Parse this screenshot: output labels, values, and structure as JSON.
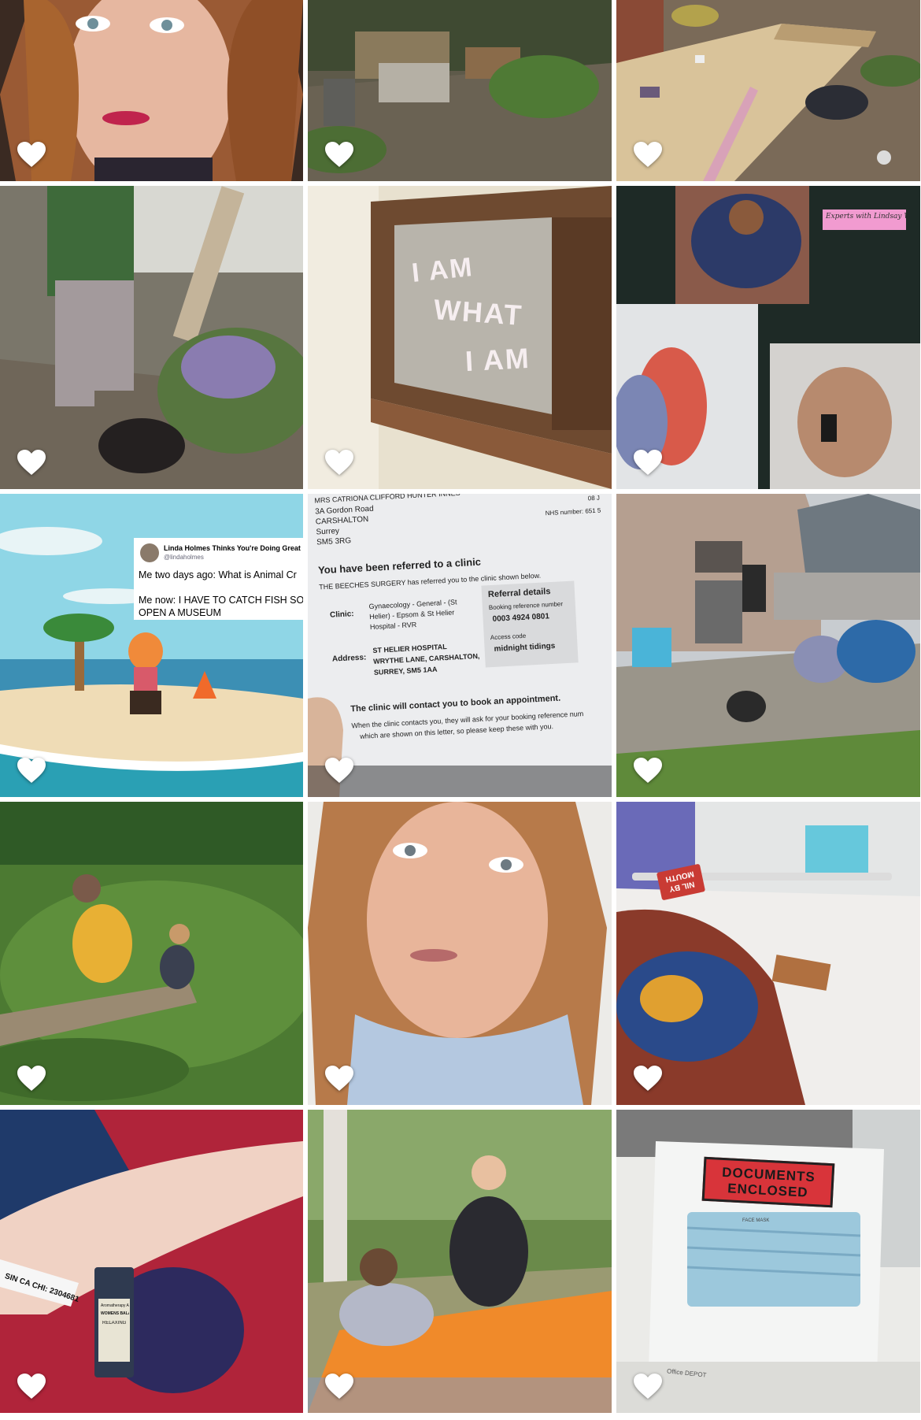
{
  "grid": {
    "heart_color": "#ffffff",
    "tiles": [
      {
        "subject": "selfie-woman-red-hair"
      },
      {
        "subject": "garden-rubble"
      },
      {
        "subject": "wooden-deck"
      },
      {
        "subject": "man-sitting-garden"
      },
      {
        "subject": "window-graffiti"
      },
      {
        "subject": "photo-collage"
      },
      {
        "subject": "animal-crossing-tweet"
      },
      {
        "subject": "clinic-referral-letter"
      },
      {
        "subject": "backyard-bbq"
      },
      {
        "subject": "meadow-log"
      },
      {
        "subject": "selfie-grimace"
      },
      {
        "subject": "hospital-bed"
      },
      {
        "subject": "hospital-wristband"
      },
      {
        "subject": "picnic-couple"
      },
      {
        "subject": "documents-enclosed-mask"
      }
    ]
  },
  "window_graffiti": {
    "line1": "I AM",
    "line2": "WHAT",
    "line3": "I AM"
  },
  "collage": {
    "sticky_note": "Experts with Lindsay W"
  },
  "tweet": {
    "name": "Linda Holmes Thinks You're Doing Great",
    "handle": "@lindaholmes",
    "line1": "Me two days ago: What is Animal Cr",
    "line2": "Me now: I HAVE TO CATCH FISH SO",
    "line3": "OPEN A MUSEUM"
  },
  "letter": {
    "recipient": "MRS CATRIONA CLIFFORD HUNTER INNES",
    "addr1": "3A Gordon Road",
    "addr2": "CARSHALTON",
    "addr3": "Surrey",
    "addr4": "SM5 3RG",
    "date": "08 J",
    "nhs_number": "NHS number: 651 5",
    "heading": "You have been referred to a clinic",
    "intro": "THE BEECHES SURGERY has referred you to the clinic shown below.",
    "clinic_label": "Clinic:",
    "clinic_1": "Gynaecology - General - (St",
    "clinic_2": "Helier) - Epsom & St Helier",
    "clinic_3": "Hospital - RVR",
    "address_label": "Address:",
    "address_1": "ST HELIER HOSPITAL",
    "address_2": "WRYTHE LANE, CARSHALTON,",
    "address_3": "SURREY, SM5 1AA",
    "referral_title": "Referral details",
    "booking_label": "Booking reference number",
    "booking_value": "0003 4924 0801",
    "access_label": "Access code",
    "access_value": "midnight tidings",
    "contact_heading": "The clinic will contact you to book an appointment.",
    "contact_1": "When the clinic contacts you, they will ask for your booking reference num",
    "contact_2": "which are shown on this letter, so please keep these with you."
  },
  "hospital": {
    "sign": "NIL BY MOUTH"
  },
  "wristband": {
    "text": "SIN CA CHI: 2304681",
    "bottle_label_1": "Aromatherapy Associates",
    "bottle_label_2": "WOMENS BALANCE",
    "bottle_label_3": "RELAXING"
  },
  "documents": {
    "label_1": "DOCUMENTS",
    "label_2": "ENCLOSED",
    "mask_label": "FACE MASK",
    "brand": "Office DEPOT"
  }
}
